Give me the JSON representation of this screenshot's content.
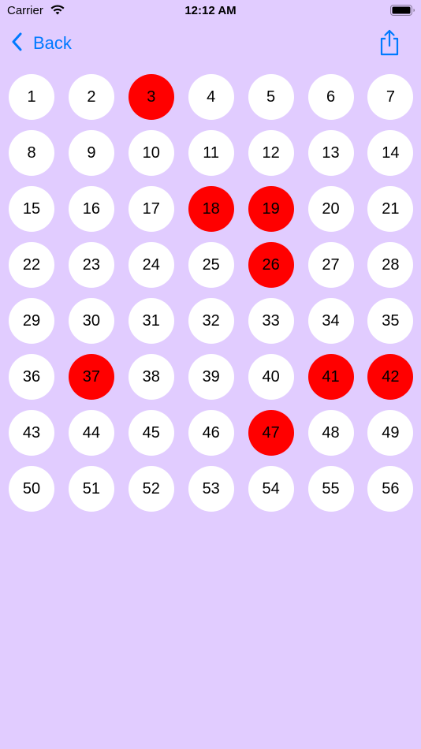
{
  "status_bar": {
    "carrier": "Carrier",
    "time": "12:12 AM"
  },
  "nav": {
    "back_label": "Back",
    "share_icon": "share-icon",
    "accent_color": "#007aff"
  },
  "colors": {
    "background": "#e1ccff",
    "ball_default": "#ffffff",
    "ball_selected": "#ff0000"
  },
  "balls": [
    {
      "number": "1",
      "selected": false
    },
    {
      "number": "2",
      "selected": false
    },
    {
      "number": "3",
      "selected": true
    },
    {
      "number": "4",
      "selected": false
    },
    {
      "number": "5",
      "selected": false
    },
    {
      "number": "6",
      "selected": false
    },
    {
      "number": "7",
      "selected": false
    },
    {
      "number": "8",
      "selected": false
    },
    {
      "number": "9",
      "selected": false
    },
    {
      "number": "10",
      "selected": false
    },
    {
      "number": "11",
      "selected": false
    },
    {
      "number": "12",
      "selected": false
    },
    {
      "number": "13",
      "selected": false
    },
    {
      "number": "14",
      "selected": false
    },
    {
      "number": "15",
      "selected": false
    },
    {
      "number": "16",
      "selected": false
    },
    {
      "number": "17",
      "selected": false
    },
    {
      "number": "18",
      "selected": true
    },
    {
      "number": "19",
      "selected": true
    },
    {
      "number": "20",
      "selected": false
    },
    {
      "number": "21",
      "selected": false
    },
    {
      "number": "22",
      "selected": false
    },
    {
      "number": "23",
      "selected": false
    },
    {
      "number": "24",
      "selected": false
    },
    {
      "number": "25",
      "selected": false
    },
    {
      "number": "26",
      "selected": true
    },
    {
      "number": "27",
      "selected": false
    },
    {
      "number": "28",
      "selected": false
    },
    {
      "number": "29",
      "selected": false
    },
    {
      "number": "30",
      "selected": false
    },
    {
      "number": "31",
      "selected": false
    },
    {
      "number": "32",
      "selected": false
    },
    {
      "number": "33",
      "selected": false
    },
    {
      "number": "34",
      "selected": false
    },
    {
      "number": "35",
      "selected": false
    },
    {
      "number": "36",
      "selected": false
    },
    {
      "number": "37",
      "selected": true
    },
    {
      "number": "38",
      "selected": false
    },
    {
      "number": "39",
      "selected": false
    },
    {
      "number": "40",
      "selected": false
    },
    {
      "number": "41",
      "selected": true
    },
    {
      "number": "42",
      "selected": true
    },
    {
      "number": "43",
      "selected": false
    },
    {
      "number": "44",
      "selected": false
    },
    {
      "number": "45",
      "selected": false
    },
    {
      "number": "46",
      "selected": false
    },
    {
      "number": "47",
      "selected": true
    },
    {
      "number": "48",
      "selected": false
    },
    {
      "number": "49",
      "selected": false
    },
    {
      "number": "50",
      "selected": false
    },
    {
      "number": "51",
      "selected": false
    },
    {
      "number": "52",
      "selected": false
    },
    {
      "number": "53",
      "selected": false
    },
    {
      "number": "54",
      "selected": false
    },
    {
      "number": "55",
      "selected": false
    },
    {
      "number": "56",
      "selected": false
    }
  ]
}
